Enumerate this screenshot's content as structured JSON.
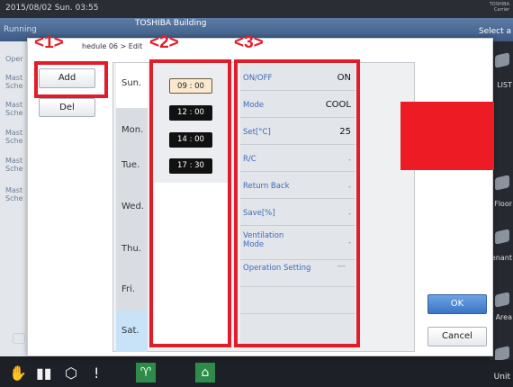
{
  "status_bar": {
    "datetime": "2015/08/02 Sun. 03:55",
    "brand": [
      "TOSHIBA",
      "Carrier"
    ]
  },
  "header": {
    "running": "Running",
    "building": "TOSHIBA Building",
    "select_all": "Select a"
  },
  "left_panel": {
    "items": [
      "Oper",
      "Mast",
      "Sche",
      "Mast",
      "Sche",
      "Mast",
      "Sche",
      "Mast",
      "Sche",
      "Mast",
      "Sche"
    ]
  },
  "right_panel": {
    "items": [
      "LIST",
      "Floor",
      "Tenant",
      "Area",
      "Unit"
    ]
  },
  "dialog": {
    "breadcrumb": "hedule 06 > Edit",
    "add_label": "Add",
    "del_label": "Del",
    "ok_label": "OK",
    "cancel_label": "Cancel",
    "days": [
      "Sun.",
      "Mon.",
      "Tue.",
      "Wed.",
      "Thu.",
      "Fri.",
      "Sat."
    ],
    "selected_day": "Sat.",
    "times": [
      "09 : 00",
      "12 : 00",
      "14 : 00",
      "17 : 30"
    ],
    "selected_time": "09 : 00",
    "settings": [
      {
        "label": "ON/OFF",
        "value": "ON"
      },
      {
        "label": "Mode",
        "value": "COOL"
      },
      {
        "label": "Set[°C]",
        "value": "25"
      },
      {
        "label": "R/C",
        "value": "-"
      },
      {
        "label": "Return Back",
        "value": "-"
      },
      {
        "label": "Save[%]",
        "value": "-"
      },
      {
        "label": "Ventilation Mode",
        "value": "-"
      },
      {
        "label": "Operation Setting",
        "value": "---"
      }
    ]
  },
  "callouts": [
    "<1>",
    "<2>",
    "<3>"
  ],
  "colors": {
    "callout": "#e21d2a",
    "header": "#4a6a96",
    "ok_button": "#3a74c4",
    "selected_day": "#c8e3f8"
  }
}
